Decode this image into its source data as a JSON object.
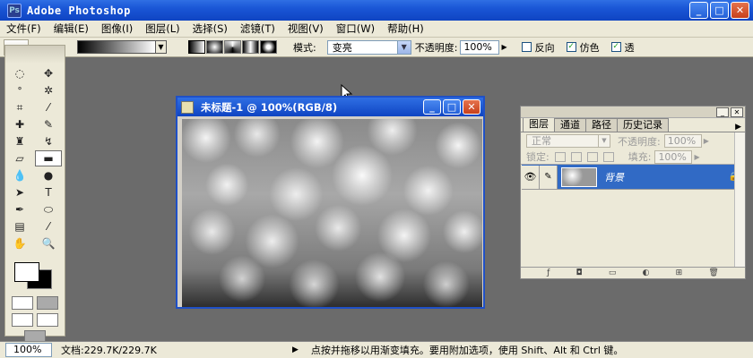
{
  "app": {
    "title": "Adobe Photoshop"
  },
  "menu": [
    "文件(F)",
    "编辑(E)",
    "图像(I)",
    "图层(L)",
    "选择(S)",
    "滤镜(T)",
    "视图(V)",
    "窗口(W)",
    "帮助(H)"
  ],
  "options": {
    "mode_label": "模式:",
    "mode_value": "变亮",
    "opacity_label": "不透明度:",
    "opacity_value": "100%",
    "reverse_label": "反向",
    "reverse_checked": false,
    "dither_label": "仿色",
    "dither_checked": true,
    "transparency_label": "透",
    "transparency_checked": true
  },
  "document": {
    "title": "未标题-1 @ 100%(RGB/8)"
  },
  "layers_panel": {
    "tabs": [
      "图层",
      "通道",
      "路径",
      "历史记录"
    ],
    "blend_mode": "正常",
    "opacity_label": "不透明度:",
    "opacity_value": "100%",
    "lock_label": "锁定:",
    "fill_label": "填充:",
    "fill_value": "100%",
    "layer_name": "背景"
  },
  "status": {
    "zoom": "100%",
    "doc_info": "文档:229.7K/229.7K",
    "message": "点按并拖移以用渐变填充。要用附加选项，使用 Shift、Alt 和 Ctrl 键。"
  },
  "colors": {
    "title_bar": "#1a56d6",
    "workspace": "#6b6b6b",
    "panel": "#ece9d8",
    "selected_layer": "#316ac5"
  }
}
